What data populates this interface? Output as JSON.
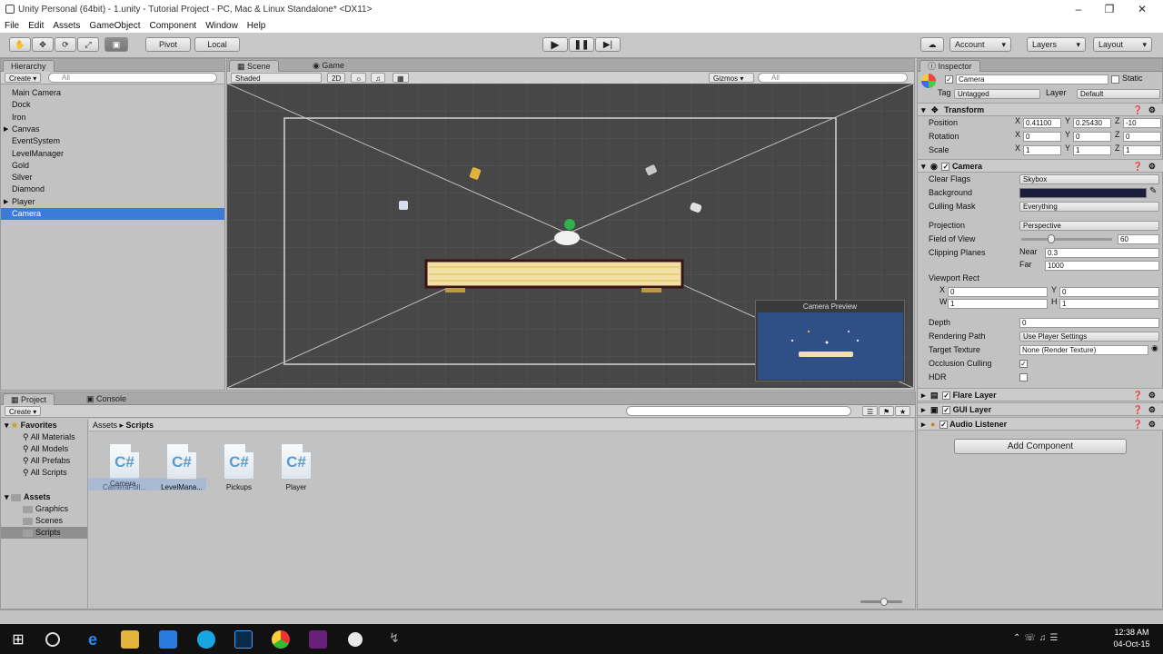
{
  "window": {
    "title": "Unity Personal (64bit) - 1.unity - Tutorial Project - PC, Mac & Linux Standalone* <DX11>"
  },
  "menu": [
    "File",
    "Edit",
    "Assets",
    "GameObject",
    "Component",
    "Window",
    "Help"
  ],
  "toolbar": {
    "pivot": "Pivot",
    "local": "Local",
    "account": "Account",
    "layers": "Layers",
    "layout": "Layout"
  },
  "hierarchy": {
    "tab": "Hierarchy",
    "create": "Create",
    "search_placeholder": "All",
    "items": [
      {
        "label": "Main Camera",
        "expandable": false,
        "selected": false
      },
      {
        "label": "Dock",
        "expandable": false,
        "selected": false
      },
      {
        "label": "Iron",
        "expandable": false,
        "selected": false
      },
      {
        "label": "Canvas",
        "expandable": true,
        "selected": false
      },
      {
        "label": "EventSystem",
        "expandable": false,
        "selected": false
      },
      {
        "label": "LevelManager",
        "expandable": false,
        "selected": false
      },
      {
        "label": "Gold",
        "expandable": false,
        "selected": false
      },
      {
        "label": "Silver",
        "expandable": false,
        "selected": false
      },
      {
        "label": "Diamond",
        "expandable": false,
        "selected": false
      },
      {
        "label": "Player",
        "expandable": true,
        "selected": false
      },
      {
        "label": "Camera",
        "expandable": false,
        "selected": true
      }
    ]
  },
  "scene": {
    "tab_scene": "Scene",
    "tab_game": "Game",
    "shading": "Shaded",
    "mode_2d": "2D",
    "gizmos": "Gizmos",
    "search_placeholder": "All",
    "camera_preview_title": "Camera Preview"
  },
  "project": {
    "tab_project": "Project",
    "tab_console": "Console",
    "create": "Create",
    "favorites_label": "Favorites",
    "favorites": [
      "All Materials",
      "All Models",
      "All Prefabs",
      "All Scripts"
    ],
    "assets_label": "Assets",
    "asset_folders": [
      "Graphics",
      "Scenes",
      "Scripts"
    ],
    "breadcrumb_root": "Assets",
    "breadcrumb_current": "Scripts",
    "files": [
      "CameraFoll...",
      "LevelMana...",
      "Pickups",
      "Player"
    ],
    "drag_label": "Camera"
  },
  "inspector": {
    "tab": "Inspector",
    "object_name": "Camera",
    "static_label": "Static",
    "tag_label": "Tag",
    "tag_value": "Untagged",
    "layer_label": "Layer",
    "layer_value": "Default",
    "transform": {
      "title": "Transform",
      "position_label": "Position",
      "rotation_label": "Rotation",
      "scale_label": "Scale",
      "position": {
        "x": "0.41100",
        "y": "0.25430",
        "z": "-10"
      },
      "rotation": {
        "x": "0",
        "y": "0",
        "z": "0"
      },
      "scale": {
        "x": "1",
        "y": "1",
        "z": "1"
      }
    },
    "camera": {
      "title": "Camera",
      "clear_flags_label": "Clear Flags",
      "clear_flags": "Skybox",
      "background_label": "Background",
      "background_color": "#1b1d3c",
      "culling_mask_label": "Culling Mask",
      "culling_mask": "Everything",
      "projection_label": "Projection",
      "projection": "Perspective",
      "fov_label": "Field of View",
      "fov": "60",
      "fov_fraction": 0.33,
      "clipping_label": "Clipping Planes",
      "near_label": "Near",
      "near": "0.3",
      "far_label": "Far",
      "far": "1000",
      "viewport_label": "Viewport Rect",
      "vx": "0",
      "vy": "0",
      "vw": "1",
      "vh": "1",
      "depth_label": "Depth",
      "depth": "0",
      "rendering_path_label": "Rendering Path",
      "rendering_path": "Use Player Settings",
      "target_texture_label": "Target Texture",
      "target_texture": "None (Render Texture)",
      "occlusion_label": "Occlusion Culling",
      "hdr_label": "HDR"
    },
    "components": [
      "Flare Layer",
      "GUI Layer",
      "Audio Listener"
    ],
    "add_component": "Add Component"
  },
  "taskbar": {
    "time": "12:38 AM",
    "date": "04-Oct-15"
  }
}
